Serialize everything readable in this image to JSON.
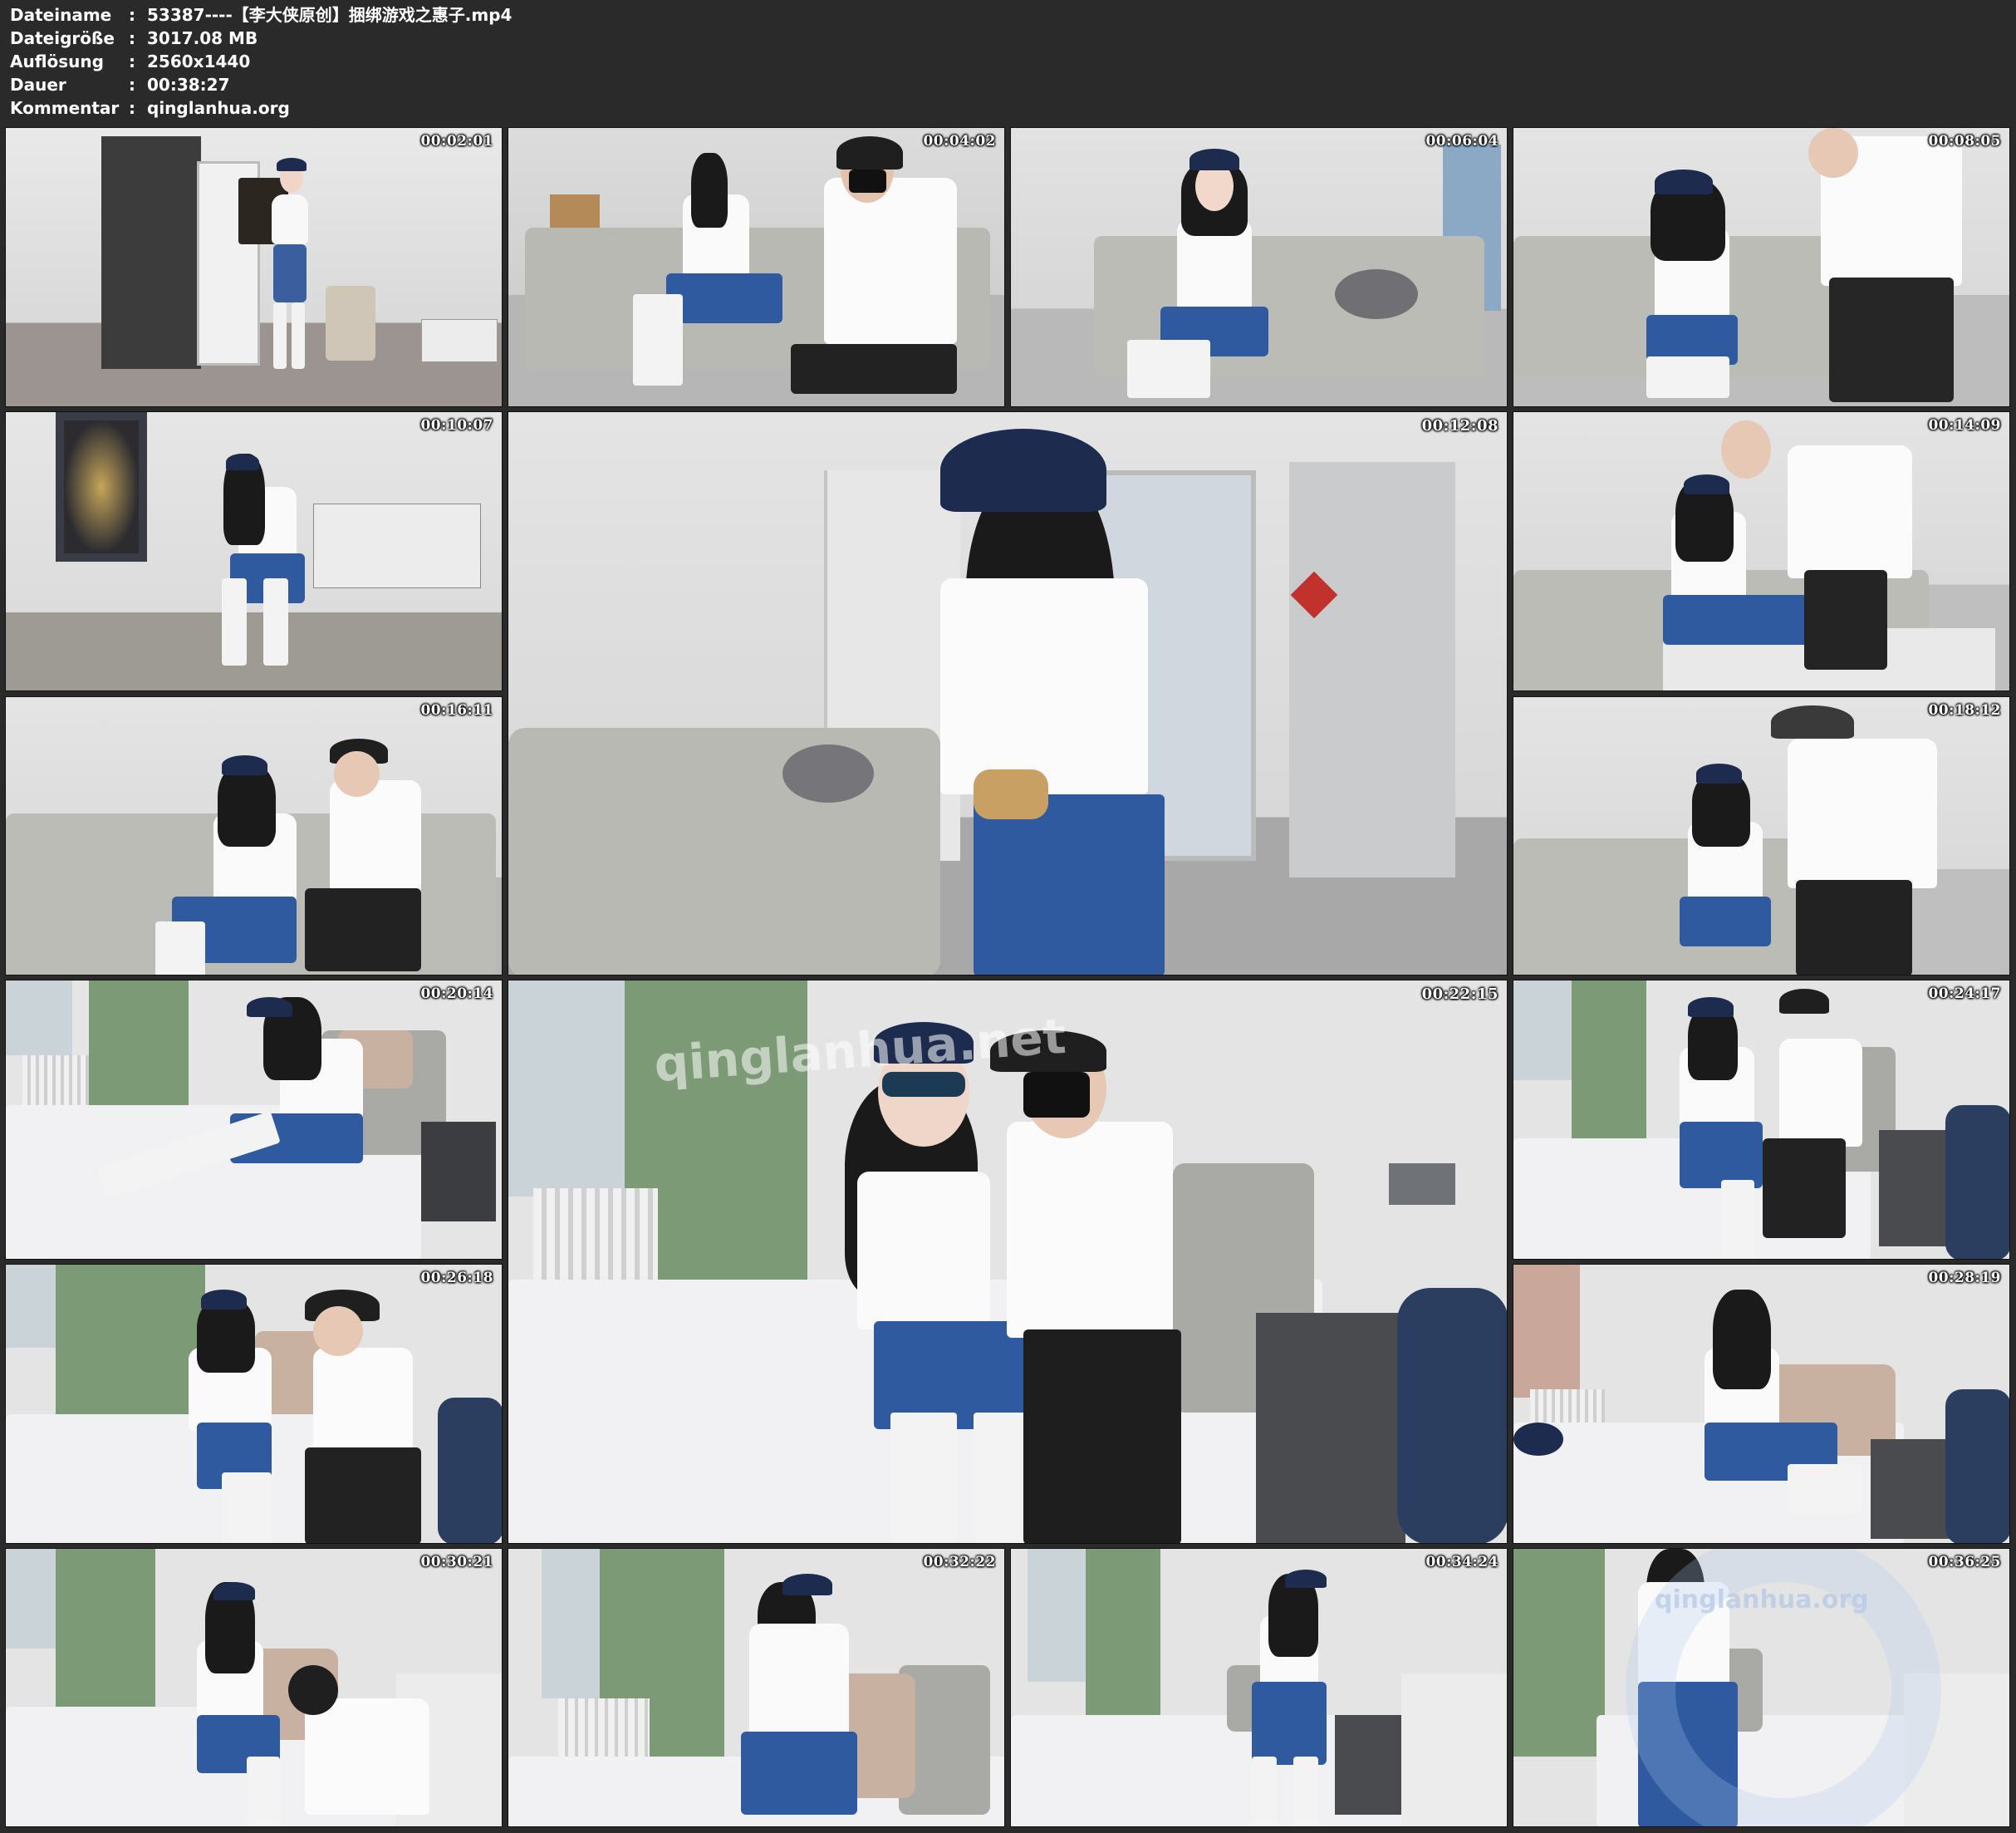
{
  "header": {
    "rows": [
      {
        "label": "Dateiname",
        "sep": ":",
        "value": "53387----【李大侠原创】捆绑游戏之惠子.mp4"
      },
      {
        "label": "Dateigröße",
        "sep": ":",
        "value": "3017.08 MB"
      },
      {
        "label": "Auflösung",
        "sep": ":",
        "value": "2560x1440"
      },
      {
        "label": "Dauer",
        "sep": ":",
        "value": "00:38:27"
      },
      {
        "label": "Kommentar",
        "sep": ":",
        "value": "qinglanhua.org"
      }
    ]
  },
  "thumbnails": [
    {
      "timestamp": "00:02:01"
    },
    {
      "timestamp": "00:04:02"
    },
    {
      "timestamp": "00:06:04"
    },
    {
      "timestamp": "00:08:05"
    },
    {
      "timestamp": "00:10:07"
    },
    {
      "timestamp": "00:12:08"
    },
    {
      "timestamp": "00:14:09"
    },
    {
      "timestamp": "00:16:11"
    },
    {
      "timestamp": "00:18:12"
    },
    {
      "timestamp": "00:20:14"
    },
    {
      "timestamp": "00:22:15"
    },
    {
      "timestamp": "00:24:17"
    },
    {
      "timestamp": "00:26:18"
    },
    {
      "timestamp": "00:28:19"
    },
    {
      "timestamp": "00:30:21"
    },
    {
      "timestamp": "00:32:22"
    },
    {
      "timestamp": "00:34:24"
    },
    {
      "timestamp": "00:36:25"
    }
  ],
  "watermarks": {
    "large_frame": "qinglanhua.net",
    "corner_frame": "qinglanhua.org"
  },
  "colors": {
    "background": "#2a2a2a",
    "header_text": "#ffffff",
    "sofa": "#b9b9b4",
    "jeans": "#2f5aa0",
    "curtain": "#7c9a76",
    "cap": "#1c2b4e"
  }
}
